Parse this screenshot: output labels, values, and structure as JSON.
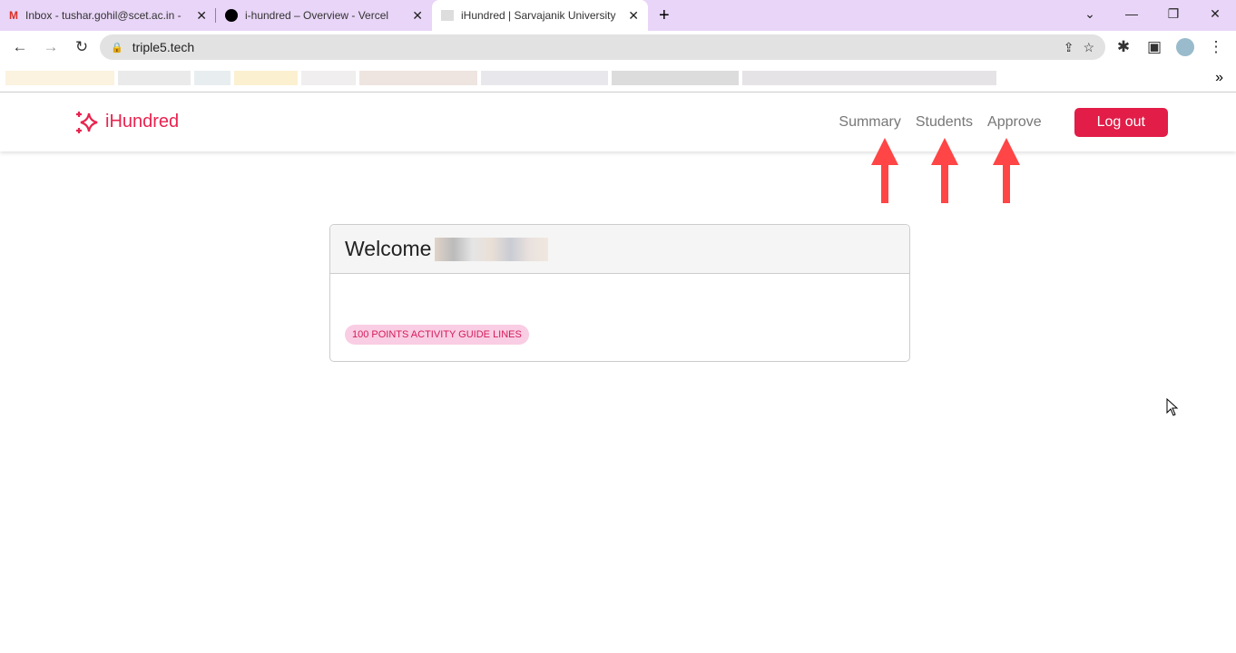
{
  "browser": {
    "tabs": [
      {
        "title": "Inbox - tushar.gohil@scet.ac.in -",
        "icon": "gmail-icon"
      },
      {
        "title": "i-hundred – Overview - Vercel",
        "icon": "vercel-icon"
      },
      {
        "title": "iHundred | Sarvajanik University",
        "icon": "site-favicon",
        "active": true
      }
    ],
    "url": "triple5.tech"
  },
  "navbar": {
    "brand": "iHundred",
    "links": [
      "Summary",
      "Students",
      "Approve"
    ],
    "logout": "Log out"
  },
  "card": {
    "welcome": "Welcome",
    "badge": "100 POINTS ACTIVITY GUIDE LINES"
  },
  "colors": {
    "brand": "#e8234f",
    "button": "#e11d48",
    "badge_bg": "#f9cde3",
    "arrow": "#ff4040"
  }
}
